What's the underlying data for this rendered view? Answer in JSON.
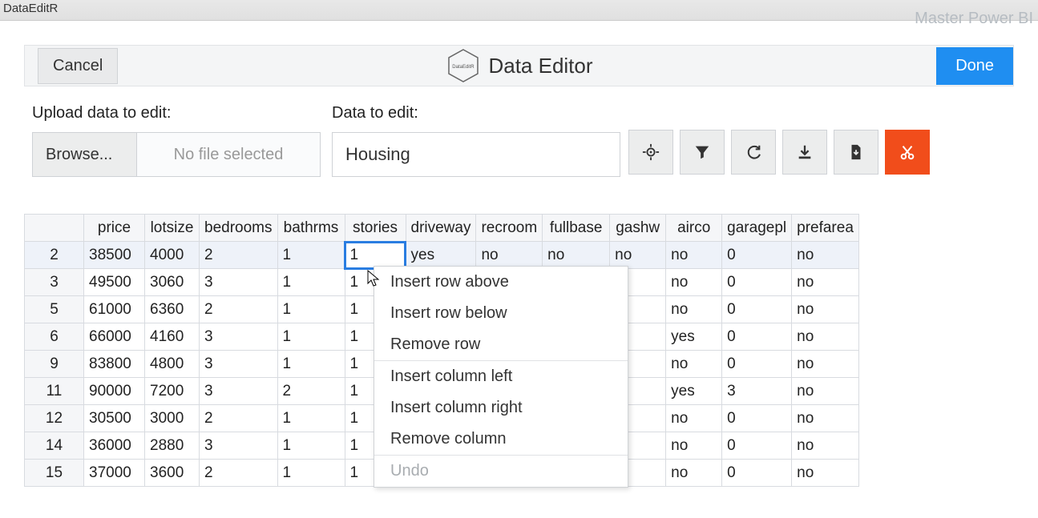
{
  "top_tab": "DataEditR",
  "watermark": "Master Power BI",
  "toolbar": {
    "cancel": "Cancel",
    "title": "Data Editor",
    "done": "Done",
    "hex_label": "DataEditR"
  },
  "upload": {
    "label": "Upload data to edit:",
    "browse": "Browse...",
    "no_file": "No file selected"
  },
  "dataset": {
    "label": "Data to edit:",
    "value": "Housing"
  },
  "icons": {
    "target": "target-icon",
    "filter": "filter-icon",
    "sync": "sync-icon",
    "download": "download-icon",
    "save": "save-file-icon",
    "cut": "cut-icon"
  },
  "columns": [
    "price",
    "lotsize",
    "bedrooms",
    "bathrms",
    "stories",
    "driveway",
    "recroom",
    "fullbase",
    "gashw",
    "airco",
    "garagepl",
    "prefarea"
  ],
  "rows": [
    {
      "n": "2",
      "c": [
        "38500",
        "4000",
        "2",
        "1",
        "1",
        "yes",
        "no",
        "no",
        "no",
        "no",
        "0",
        "no"
      ]
    },
    {
      "n": "3",
      "c": [
        "49500",
        "3060",
        "3",
        "1",
        "1",
        "",
        "",
        "",
        "",
        "no",
        "0",
        "no"
      ]
    },
    {
      "n": "5",
      "c": [
        "61000",
        "6360",
        "2",
        "1",
        "1",
        "",
        "",
        "",
        "",
        "no",
        "0",
        "no"
      ]
    },
    {
      "n": "6",
      "c": [
        "66000",
        "4160",
        "3",
        "1",
        "1",
        "",
        "",
        "",
        "",
        "yes",
        "0",
        "no"
      ]
    },
    {
      "n": "9",
      "c": [
        "83800",
        "4800",
        "3",
        "1",
        "1",
        "",
        "",
        "",
        "",
        "no",
        "0",
        "no"
      ]
    },
    {
      "n": "11",
      "c": [
        "90000",
        "7200",
        "3",
        "2",
        "1",
        "",
        "",
        "",
        "",
        "yes",
        "3",
        "no"
      ]
    },
    {
      "n": "12",
      "c": [
        "30500",
        "3000",
        "2",
        "1",
        "1",
        "",
        "",
        "",
        "",
        "no",
        "0",
        "no"
      ]
    },
    {
      "n": "14",
      "c": [
        "36000",
        "2880",
        "3",
        "1",
        "1",
        "",
        "",
        "",
        "",
        "no",
        "0",
        "no"
      ]
    },
    {
      "n": "15",
      "c": [
        "37000",
        "3600",
        "2",
        "1",
        "1",
        "",
        "",
        "",
        "",
        "no",
        "0",
        "no"
      ]
    }
  ],
  "context_menu": {
    "items": [
      {
        "label": "Insert row above",
        "type": "item"
      },
      {
        "label": "Insert row below",
        "type": "item"
      },
      {
        "label": "Remove row",
        "type": "item"
      },
      {
        "type": "divider"
      },
      {
        "label": "Insert column left",
        "type": "item"
      },
      {
        "label": "Insert column right",
        "type": "item"
      },
      {
        "label": "Remove column",
        "type": "item"
      },
      {
        "type": "divider"
      },
      {
        "label": "Undo",
        "type": "item",
        "disabled": true
      }
    ]
  }
}
